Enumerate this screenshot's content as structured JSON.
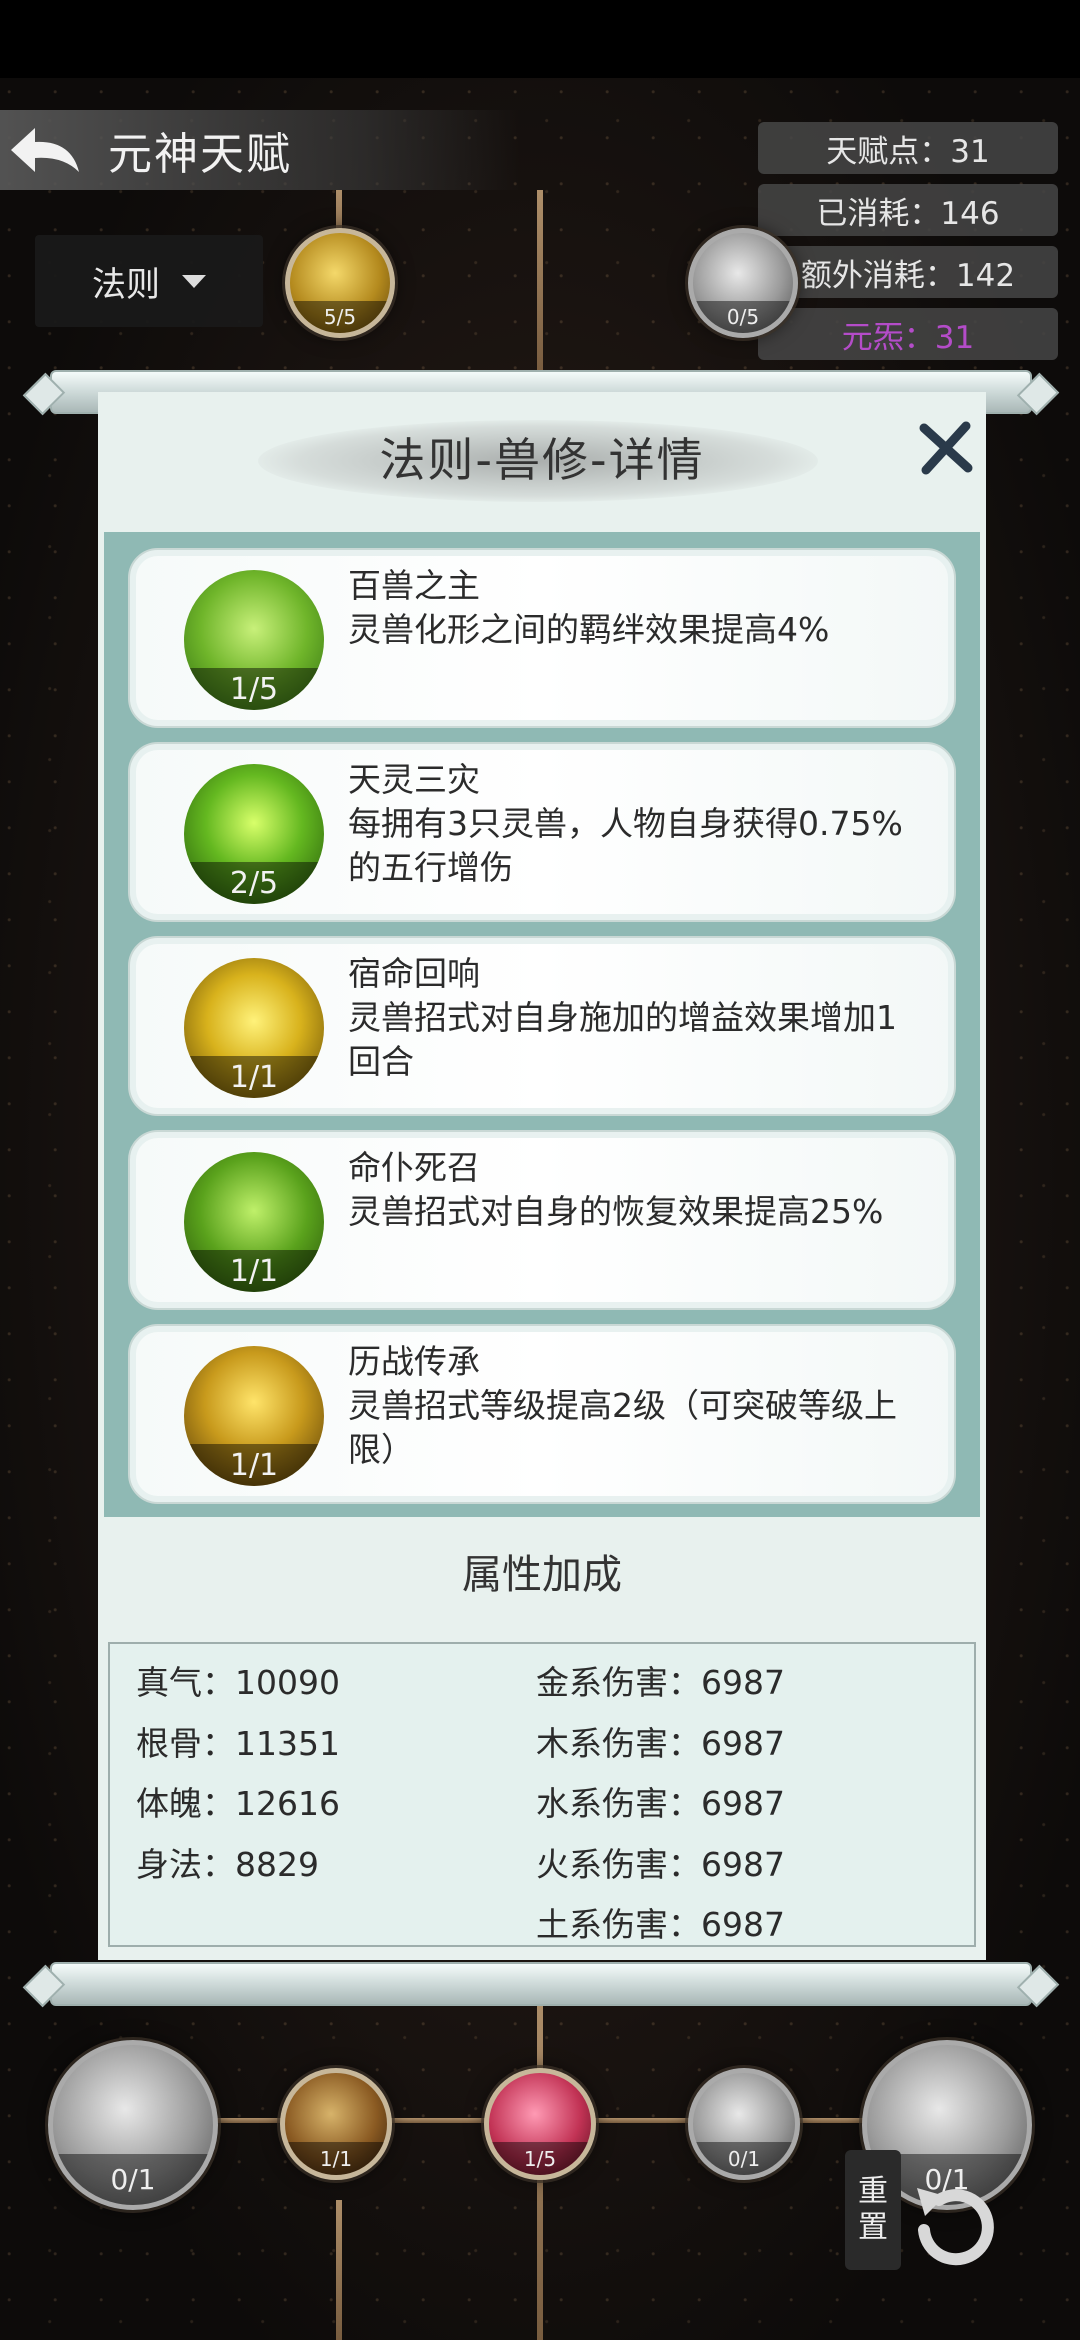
{
  "header": {
    "title": "元神天赋",
    "stats": [
      {
        "label": "天赋点：31"
      },
      {
        "label": "已消耗：146"
      },
      {
        "label": "额外消耗：142"
      },
      {
        "label": "元炁：31",
        "accent": true
      }
    ],
    "filter": {
      "selected": "法则"
    }
  },
  "tree_top": [
    {
      "count": "5/5",
      "style": "gold"
    },
    {
      "count": "0/5",
      "style": "grey"
    }
  ],
  "panel": {
    "title": "法则-兽修-详情",
    "talents": [
      {
        "name": "百兽之主",
        "desc": "灵兽化形之间的羁绊效果提高4%",
        "count": "1/5",
        "icon": "lion-head-icon"
      },
      {
        "name": "天灵三灾",
        "desc": "每拥有3只灵兽，人物自身获得0.75%的五行增伤",
        "count": "2/5",
        "icon": "green-flame-icon"
      },
      {
        "name": "宿命回响",
        "desc": "灵兽招式对自身施加的增益效果增加1回合",
        "count": "1/1",
        "icon": "golden-rings-icon"
      },
      {
        "name": "命仆死召",
        "desc": "灵兽招式对自身的恢复效果提高25%",
        "count": "1/1",
        "icon": "heal-cross-icon"
      },
      {
        "name": "历战传承",
        "desc": "灵兽招式等级提高2级（可突破等级上限）",
        "count": "1/1",
        "icon": "warrior-silhouette-icon"
      }
    ],
    "attr_title": "属性加成",
    "attrs_left": [
      "真气：10090",
      "根骨：11351",
      "体魄：12616",
      "身法：8829"
    ],
    "attrs_right": [
      "金系伤害：6987",
      "木系伤害：6987",
      "水系伤害：6987",
      "火系伤害：6987",
      "土系伤害：6987"
    ]
  },
  "tree_bottom": [
    {
      "count": "0/1",
      "style": "grey"
    },
    {
      "count": "1/1",
      "style": "dark"
    },
    {
      "count": "1/5",
      "style": "red"
    },
    {
      "count": "0/1",
      "style": "grey"
    },
    {
      "count": "0/1",
      "style": "grey"
    }
  ],
  "reset": {
    "label_top": "重",
    "label_bottom": "置"
  }
}
